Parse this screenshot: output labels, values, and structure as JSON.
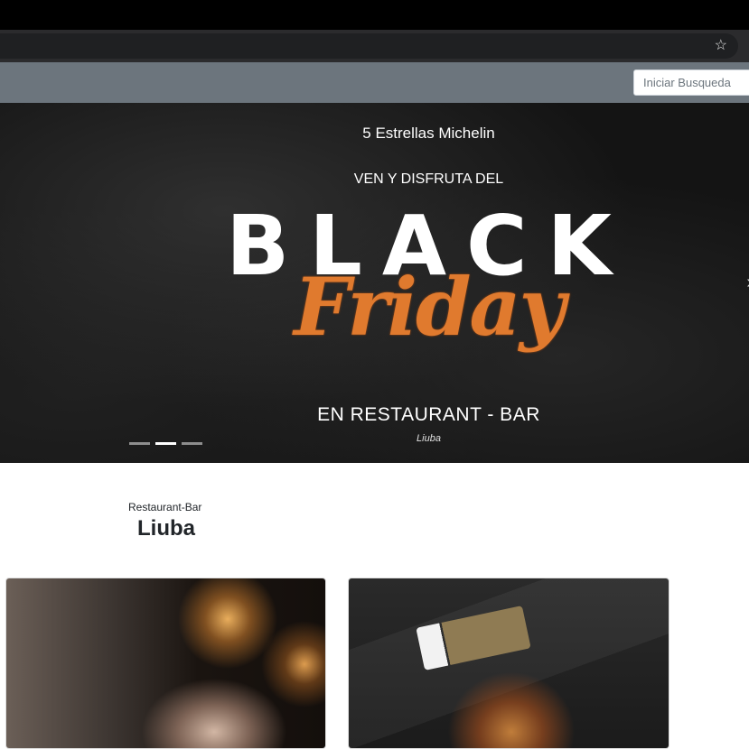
{
  "browser": {
    "bookmark_icon": "star-icon"
  },
  "navbar": {
    "search_placeholder": "Iniciar Busqueda"
  },
  "hero": {
    "rating": "5 Estrellas Michelin",
    "tagline": "VEN Y DISFRUTA DEL",
    "headline": "BLACK",
    "headline_script": "Friday",
    "location": "EN RESTAURANT - BAR",
    "caption": "Liuba",
    "slides": 3,
    "active_slide": 2,
    "next_icon": "chevron-right-icon"
  },
  "brand": {
    "subtitle": "Restaurant-Bar",
    "title": "Liuba"
  },
  "colors": {
    "navbar": "#6c757d",
    "friday_accent": "#e07a2e",
    "hero_bg": "#141414"
  }
}
